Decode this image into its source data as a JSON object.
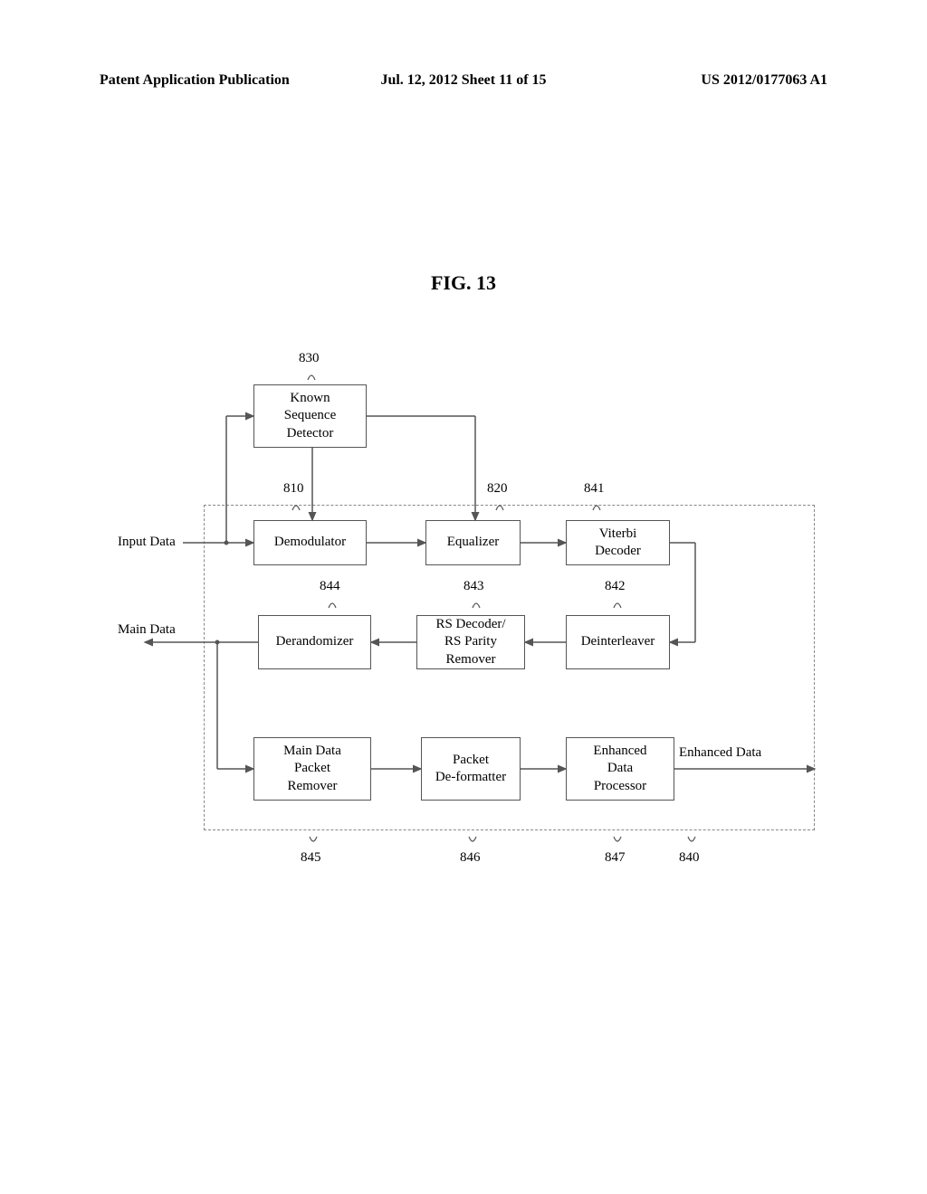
{
  "header": {
    "left": "Patent Application Publication",
    "center": "Jul. 12, 2012  Sheet 11 of 15",
    "right": "US 2012/0177063 A1"
  },
  "figure": {
    "label": "FIG. 13"
  },
  "blocks": {
    "known_sequence_detector": "Known\nSequence\nDetector",
    "demodulator": "Demodulator",
    "equalizer": "Equalizer",
    "viterbi_decoder": "Viterbi\nDecoder",
    "derandomizer": "Derandomizer",
    "rs": "RS Decoder/\nRS Parity\nRemover",
    "deinterleaver": "Deinterleaver",
    "main_remover": "Main Data\nPacket\nRemover",
    "deformatter": "Packet\nDe-formatter",
    "enhanced_proc": "Enhanced\nData\nProcessor"
  },
  "io": {
    "input_data": "Input Data",
    "main_data": "Main Data",
    "enhanced_data": "Enhanced Data"
  },
  "refs": {
    "r830": "830",
    "r810": "810",
    "r820": "820",
    "r841": "841",
    "r844": "844",
    "r843": "843",
    "r842": "842",
    "r845": "845",
    "r846": "846",
    "r847": "847",
    "r840": "840"
  }
}
